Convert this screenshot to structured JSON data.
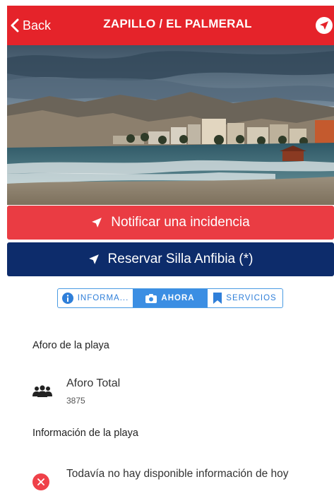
{
  "header": {
    "back_label": "Back",
    "title": "ZAPILLO / EL PALMERAL"
  },
  "actions": {
    "notify_label": "Notificar una incidencia",
    "reserve_label": "Reservar Silla Anfibia (*)"
  },
  "tabs": [
    {
      "label": "INFORMA...",
      "icon": "info-icon",
      "active": false
    },
    {
      "label": "AHORA",
      "icon": "camera-icon",
      "active": true
    },
    {
      "label": "SERVICIOS",
      "icon": "bookmark-icon",
      "active": false
    }
  ],
  "aforo": {
    "section_title": "Aforo de la playa",
    "label": "Aforo Total",
    "value": "3875"
  },
  "info": {
    "section_title": "Información de la playa",
    "message": "Todavía no hay disponible información de hoy"
  },
  "colors": {
    "header_red": "#e5232a",
    "notify_red": "#ea3c43",
    "reserve_navy": "#0d2c6b",
    "tab_blue": "#3b8ee3",
    "error_red": "#ef4149"
  }
}
